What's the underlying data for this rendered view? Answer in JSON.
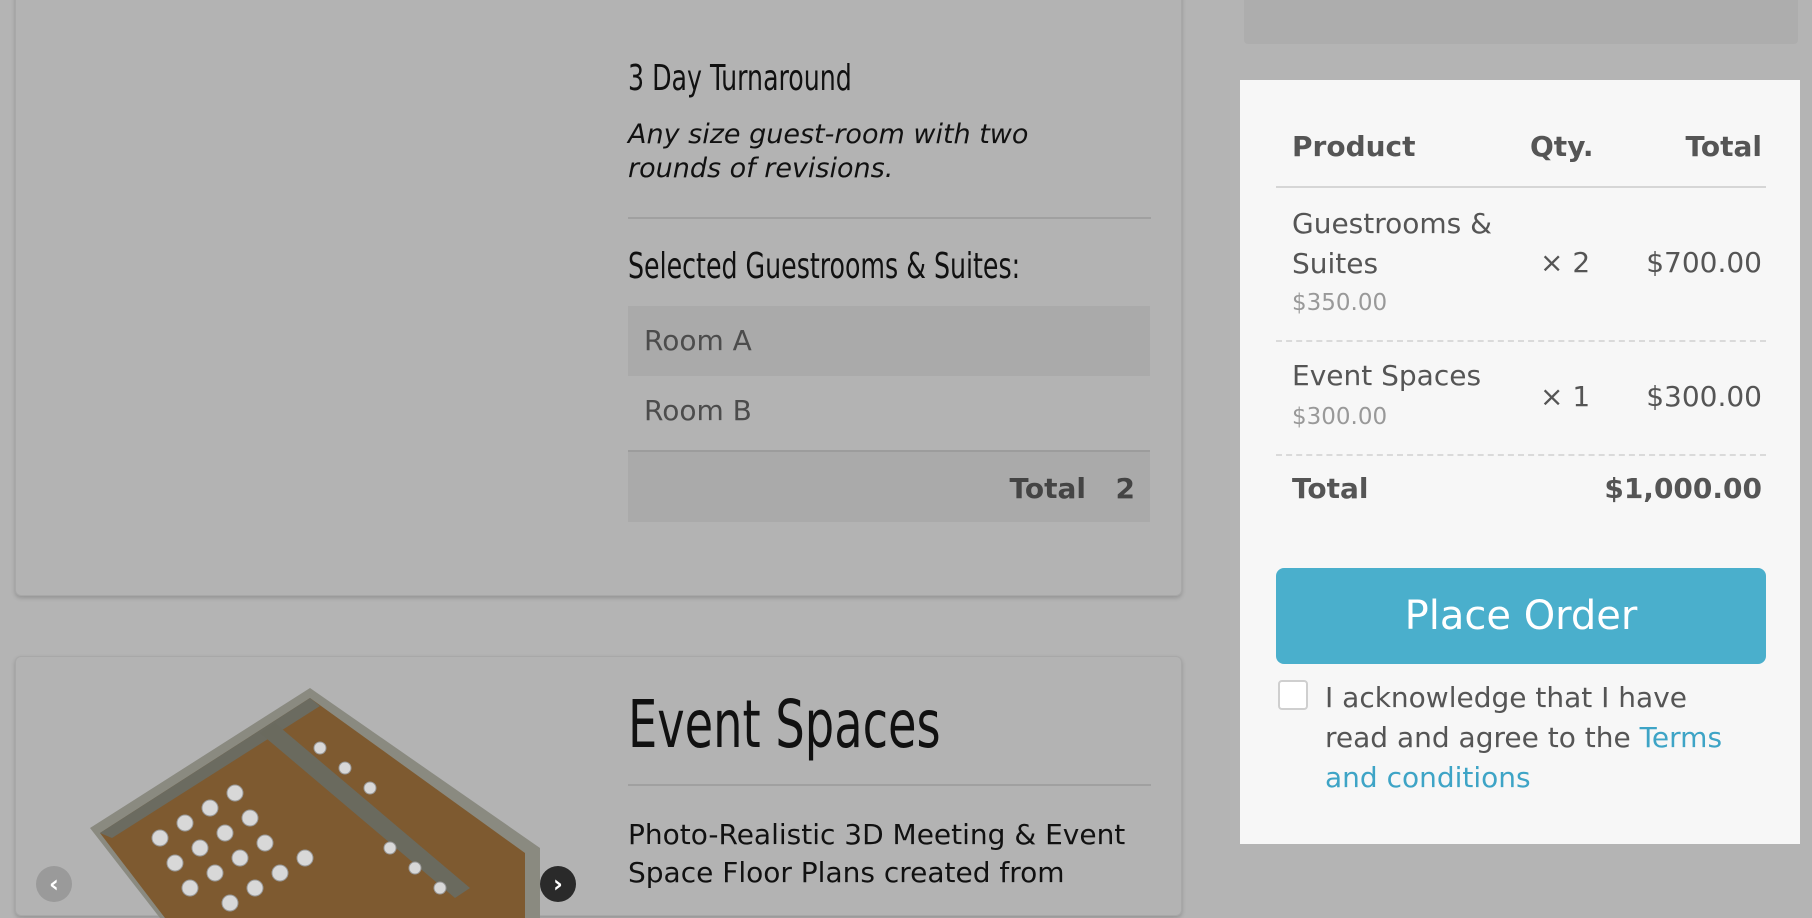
{
  "product_card": {
    "plan_title": "3 Day Turnaround",
    "plan_description": "Any size guest-room with two rounds of revisions.",
    "selected_title": "Selected Guestrooms & Suites:",
    "rooms": [
      "Room A",
      "Room B"
    ],
    "total_label": "Total",
    "total_value": "2"
  },
  "event_card": {
    "title": "Event Spaces",
    "description": "Photo-Realistic 3D Meeting & Event Space Floor Plans created from"
  },
  "order": {
    "headers": {
      "product": "Product",
      "qty": "Qty.",
      "total": "Total"
    },
    "items": [
      {
        "name": "Guestrooms & Suites",
        "unit_price": "$350.00",
        "qty": "× 2",
        "total": "$700.00"
      },
      {
        "name": "Event Spaces",
        "unit_price": "$300.00",
        "qty": "× 1",
        "total": "$300.00"
      }
    ],
    "total_label": "Total",
    "total_amount": "$1,000.00",
    "place_order_label": "Place Order",
    "ack_text": "I acknowledge that I have read and agree to the ",
    "terms_link": "Terms and conditions"
  },
  "colors": {
    "accent": "#4aafcc",
    "link": "#3ea4c6",
    "overlay_background": "#b4b4b4"
  },
  "icons": {
    "prev": "chevron-left-icon",
    "next": "chevron-right-icon"
  }
}
